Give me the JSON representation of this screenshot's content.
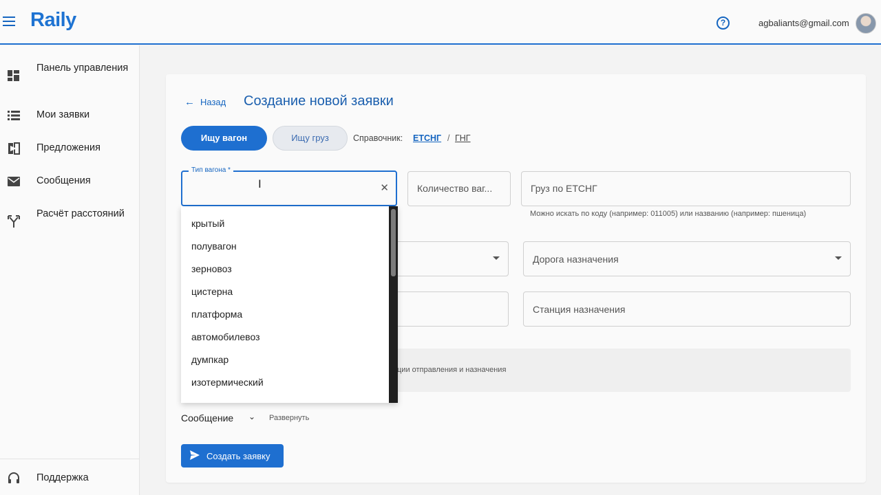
{
  "header": {
    "logo": "Raily",
    "help_glyph": "?",
    "user_email": "agbaliants@gmail.com"
  },
  "sidebar": {
    "items": [
      {
        "label": "Панель управления",
        "icon": "dashboard-icon"
      },
      {
        "label": "Мои заявки",
        "icon": "list-icon"
      },
      {
        "label": "Предложения",
        "icon": "offers-icon"
      },
      {
        "label": "Сообщения",
        "icon": "mail-icon"
      },
      {
        "label": "Расчёт расстояний",
        "icon": "route-icon"
      }
    ],
    "support": {
      "label": "Поддержка",
      "icon": "headset-icon"
    }
  },
  "page": {
    "back_label": "Назад",
    "title": "Создание новой заявки"
  },
  "mode": {
    "seek_wagon": "Ищу вагон",
    "seek_cargo": "Ищу груз",
    "active": "Ищу вагон"
  },
  "reference": {
    "label": "Справочник:",
    "etsng": "ЕТСНГ",
    "separator": "/",
    "gng": "ГНГ"
  },
  "form": {
    "wagon_type": {
      "label": "Тип вагона *",
      "value": ""
    },
    "wagon_count": {
      "placeholder": "Количество ваг..."
    },
    "cargo": {
      "placeholder": "Груз по ЕТСНГ",
      "hint": "Можно искать по коду (например: 011005) или названию (например: пшеница)"
    },
    "dest_road": {
      "placeholder": "Дорога назначения"
    },
    "dest_station": {
      "placeholder": "Станция назначения"
    },
    "info_text": "ции отправления и назначения",
    "message": {
      "label": "Сообщение",
      "expand": "Развернуть"
    },
    "submit_label": "Создать заявку"
  },
  "wagon_type_options": [
    "крытый",
    "полувагон",
    "зерновоз",
    "цистерна",
    "платформа",
    "автомобилевоз",
    "думпкар",
    "изотермический"
  ],
  "colors": {
    "accent": "#1e6fd0",
    "title": "#1b5fae"
  }
}
